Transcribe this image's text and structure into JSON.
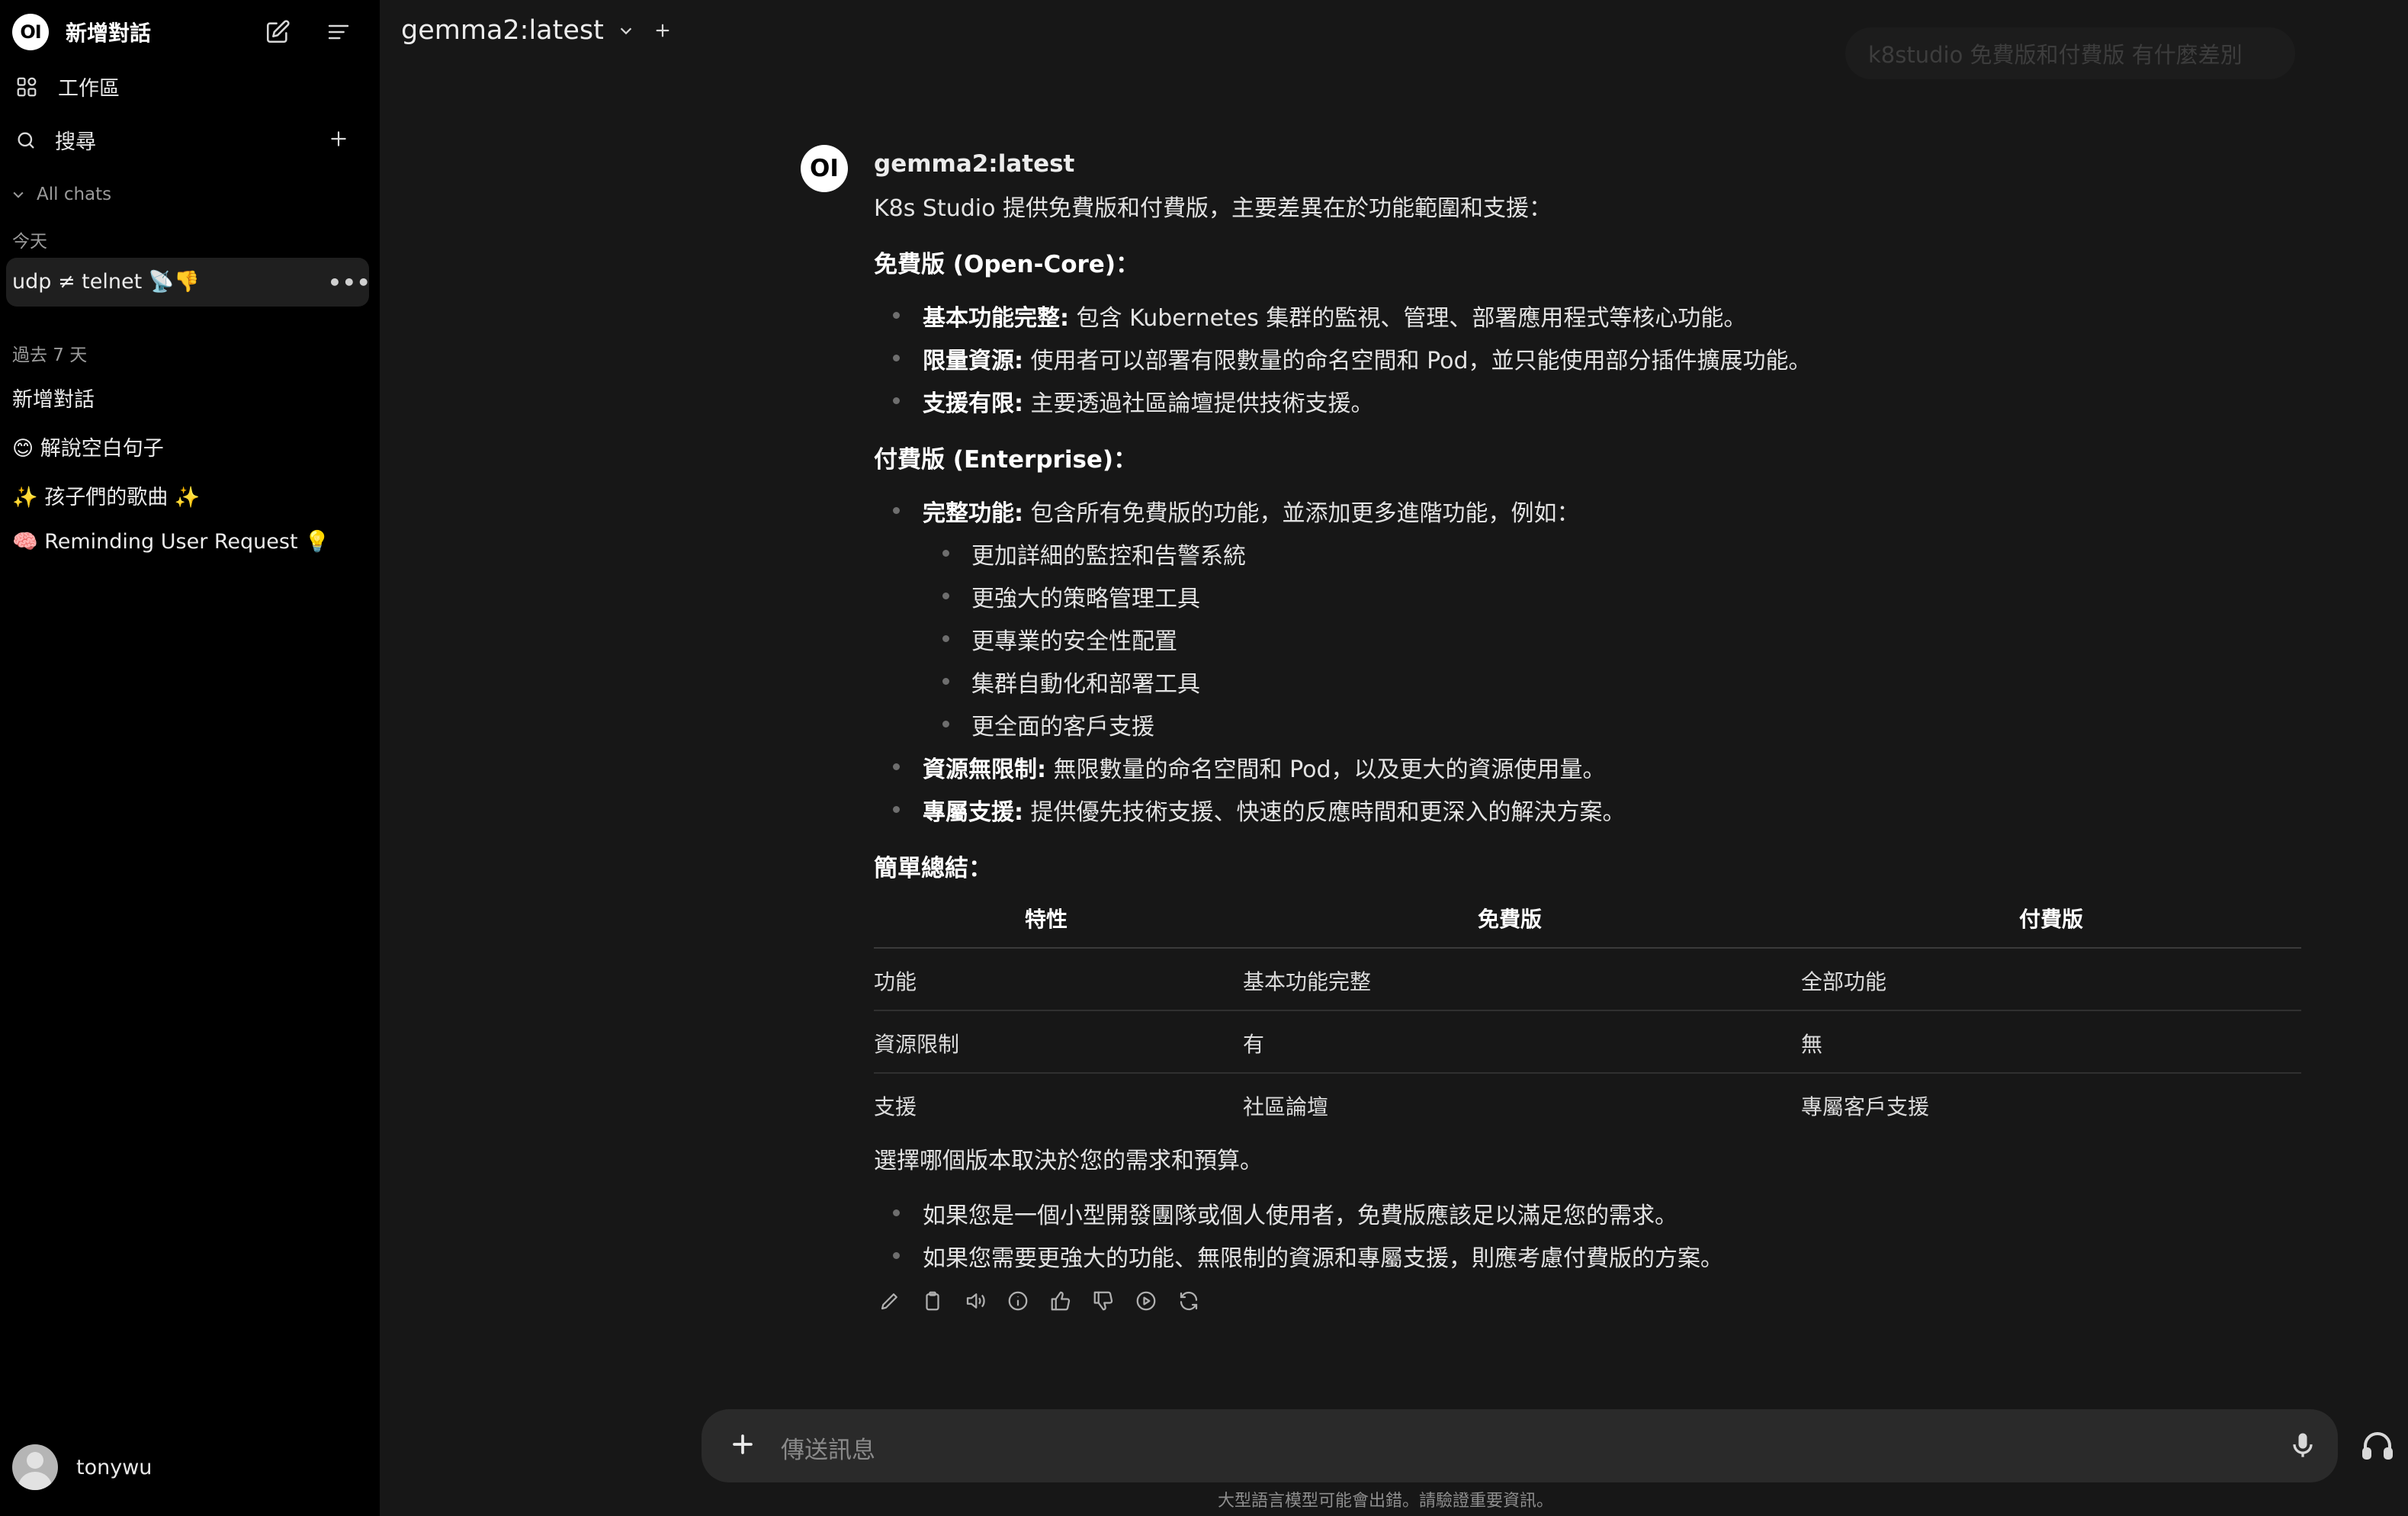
{
  "sidebar": {
    "logo_text": "OI",
    "new_chat_label": "新增對話",
    "workspace_label": "工作區",
    "search_label": "搜尋",
    "all_chats_label": "All chats",
    "today_label": "今天",
    "active_chat": "udp ≠ telnet 📡👎",
    "past7_label": "過去 7 天",
    "chats": [
      "新增對話",
      "😊 解說空白句子",
      "✨ 孩子們的歌曲 ✨",
      "🧠 Reminding User Request 💡"
    ],
    "user_name": "tonywu"
  },
  "topbar": {
    "model": "gemma2:latest",
    "faded_query": "k8studio 免費版和付費版 有什麼差別"
  },
  "message": {
    "avatar_text": "OI",
    "model_name": "gemma2:latest",
    "intro": "K8s Studio 提供免費版和付費版，主要差異在於功能範圍和支援：",
    "free_heading": "免費版 (Open-Core)：",
    "free_items": [
      {
        "bold": "基本功能完整:",
        "text": " 包含 Kubernetes 集群的監視、管理、部署應用程式等核心功能。"
      },
      {
        "bold": "限量資源:",
        "text": " 使用者可以部署有限數量的命名空間和 Pod，並只能使用部分插件擴展功能。"
      },
      {
        "bold": "支援有限:",
        "text": " 主要透過社區論壇提供技術支援。"
      }
    ],
    "paid_heading": "付費版 (Enterprise)：",
    "paid_item1": {
      "bold": "完整功能:",
      "text": " 包含所有免費版的功能，並添加更多進階功能，例如："
    },
    "paid_sub_items": [
      "更加詳細的監控和告警系統",
      "更強大的策略管理工具",
      "更專業的安全性配置",
      "集群自動化和部署工具",
      "更全面的客戶支援"
    ],
    "paid_items_rest": [
      {
        "bold": "資源無限制:",
        "text": " 無限數量的命名空間和 Pod，以及更大的資源使用量。"
      },
      {
        "bold": "專屬支援:",
        "text": " 提供優先技術支援、快速的反應時間和更深入的解決方案。"
      }
    ],
    "summary_heading": "簡單總結：",
    "table": {
      "headers": [
        "特性",
        "免費版",
        "付費版"
      ],
      "rows": [
        [
          "功能",
          "基本功能完整",
          "全部功能"
        ],
        [
          "資源限制",
          "有",
          "無"
        ],
        [
          "支援",
          "社區論壇",
          "專屬客戶支援"
        ]
      ]
    },
    "conclusion": "選擇哪個版本取決於您的需求和預算。",
    "final_items": [
      "如果您是一個小型開發團隊或個人使用者，免費版應該足以滿足您的需求。",
      "如果您需要更強大的功能、無限制的資源和專屬支援，則應考慮付費版的方案。"
    ]
  },
  "input": {
    "placeholder": "傳送訊息"
  },
  "disclaimer": "大型語言模型可能會出錯。請驗證重要資訊。",
  "colors": {
    "background": "#171717",
    "sidebar": "#000000",
    "input": "#2a2a2a"
  }
}
